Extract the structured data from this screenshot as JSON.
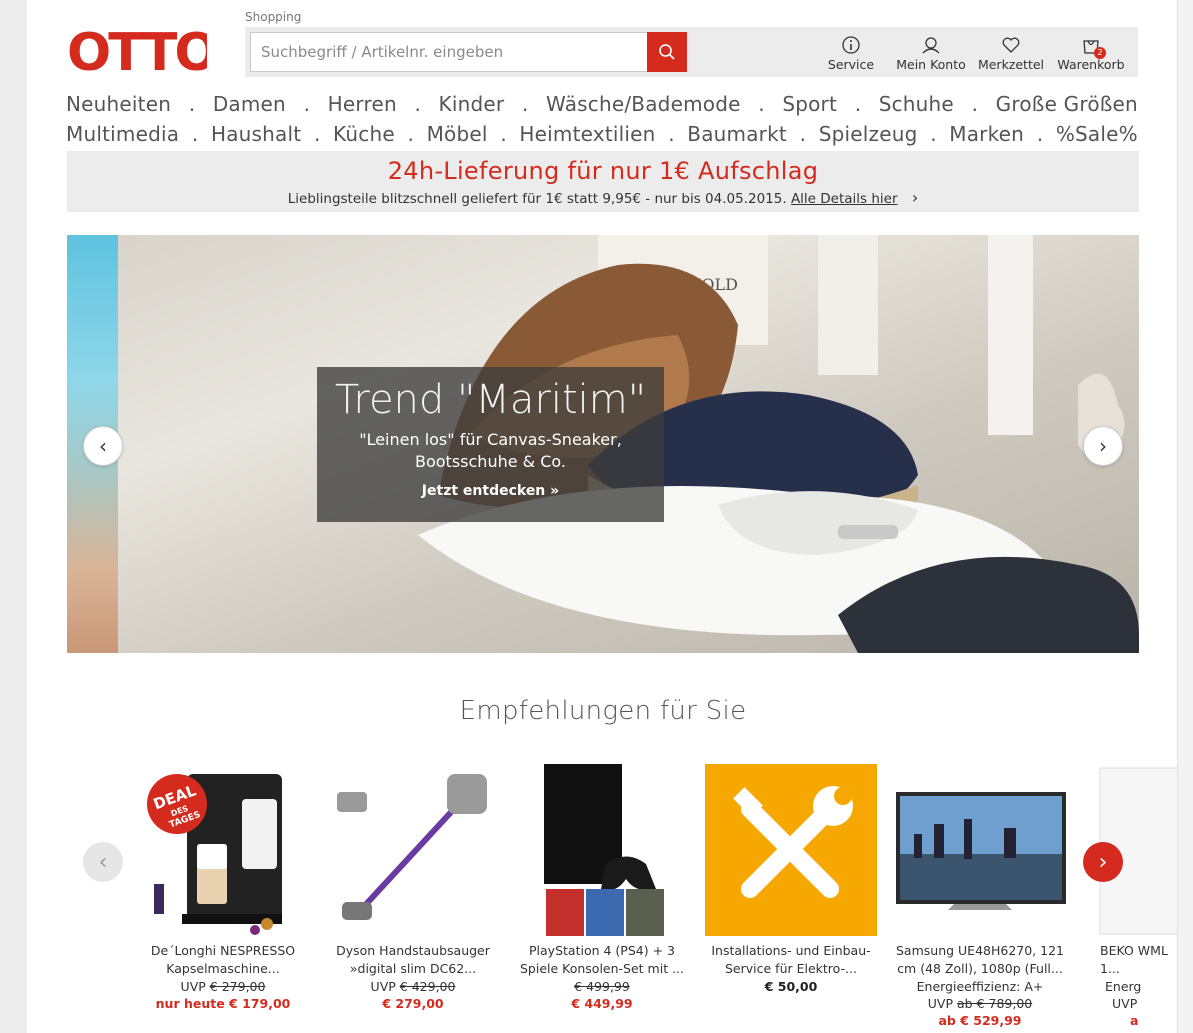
{
  "header": {
    "logo_text": "OTTO",
    "shopping_label": "Shopping",
    "search_placeholder": "Suchbegriff / Artikelnr. eingeben",
    "items": [
      {
        "label": "Service",
        "icon": "info-icon"
      },
      {
        "label": "Mein Konto",
        "icon": "user-icon"
      },
      {
        "label": "Merkzettel",
        "icon": "heart-icon"
      },
      {
        "label": "Warenkorb",
        "icon": "cart-icon",
        "badge": "2"
      }
    ]
  },
  "nav": {
    "row1": [
      "Neuheiten",
      "Damen",
      "Herren",
      "Kinder",
      "Wäsche/Bademode",
      "Sport",
      "Schuhe",
      "Große Größen"
    ],
    "row2": [
      "Multimedia",
      "Haushalt",
      "Küche",
      "Möbel",
      "Heimtextilien",
      "Baumarkt",
      "Spielzeug",
      "Marken",
      "%Sale%"
    ],
    "separator": "."
  },
  "promo": {
    "title": "24h-Lieferung für nur 1€ Aufschlag",
    "text": "Lieblingsteile blitzschnell geliefert für 1€ statt 9,95€ - nur bis 04.05.2015.",
    "link": "Alle Details hier",
    "chevron": "›"
  },
  "hero": {
    "title": "Trend \"Maritim\"",
    "subtitle_line1": "\"Leinen los\" für Canvas-Sneaker,",
    "subtitle_line2": "Bootsschuhe & Co.",
    "cta": "Jetzt entdecken »",
    "brand_box": "THRESHOLD",
    "prev": "‹",
    "next": "›"
  },
  "recommendations": {
    "title": "Empfehlungen für Sie",
    "products": [
      {
        "name": "De´Longhi NESPRESSO Kapselmaschine...",
        "uvp_label": "UVP",
        "uvp": "€ 279,00",
        "price": "nur heute € 179,00",
        "deal_badge": [
          "DEAL",
          "DES",
          "TAGES"
        ]
      },
      {
        "name": "Dyson Handstaubsauger »digital slim DC62...",
        "uvp_label": "UVP",
        "uvp": "€ 429,00",
        "price": "€ 279,00"
      },
      {
        "name": "PlayStation 4 (PS4) + 3 Spiele Konsolen-Set mit ...",
        "uvp_label": "",
        "uvp": "€ 499,99",
        "price": "€ 449,99"
      },
      {
        "name": "Installations- und Einbau-Service für Elektro-...",
        "price_black": "€ 50,00"
      },
      {
        "name": "Samsung UE48H6270, 121 cm (48 Zoll), 1080p (Full...",
        "extra": "Energieeffizienz: A+",
        "uvp_label": "UVP",
        "uvp": "ab  € 789,00",
        "price": "ab  € 529,99"
      },
      {
        "name": "BEKO WML 1...",
        "extra": "Energ",
        "uvp_label": "UVP",
        "price": "a"
      }
    ],
    "prev": "‹",
    "next": "›"
  }
}
